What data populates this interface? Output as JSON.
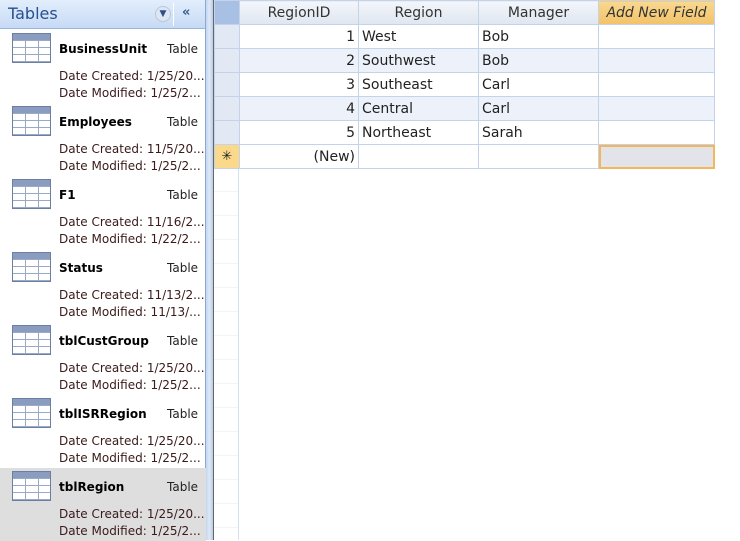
{
  "nav": {
    "title": "Tables",
    "items": [
      {
        "name": "BusinessUnit",
        "type": "Table",
        "created": "Date Created: 1/25/20...",
        "modified": "Date Modified: 1/25/2..."
      },
      {
        "name": "Employees",
        "type": "Table",
        "created": "Date Created: 11/5/20...",
        "modified": "Date Modified: 1/25/2..."
      },
      {
        "name": "F1",
        "type": "Table",
        "created": "Date Created: 11/16/2...",
        "modified": "Date Modified: 1/22/2..."
      },
      {
        "name": "Status",
        "type": "Table",
        "created": "Date Created: 11/13/2...",
        "modified": "Date Modified: 11/13/..."
      },
      {
        "name": "tblCustGroup",
        "type": "Table",
        "created": "Date Created: 1/25/20...",
        "modified": "Date Modified: 1/25/2..."
      },
      {
        "name": "tblISRRegion",
        "type": "Table",
        "created": "Date Created: 1/25/20...",
        "modified": "Date Modified: 1/25/2..."
      },
      {
        "name": "tblRegion",
        "type": "Table",
        "created": "Date Created: 1/25/20...",
        "modified": "Date Modified: 1/25/2..."
      }
    ]
  },
  "sheet": {
    "columns": [
      "RegionID",
      "Region",
      "Manager",
      "Add New Field"
    ],
    "rows": [
      [
        "1",
        "West",
        "Bob"
      ],
      [
        "2",
        "Southwest",
        "Bob"
      ],
      [
        "3",
        "Southeast",
        "Carl"
      ],
      [
        "4",
        "Central",
        "Carl"
      ],
      [
        "5",
        "Northeast",
        "Sarah"
      ]
    ],
    "new_row": {
      "marker": "✳",
      "id": "(New)"
    }
  }
}
